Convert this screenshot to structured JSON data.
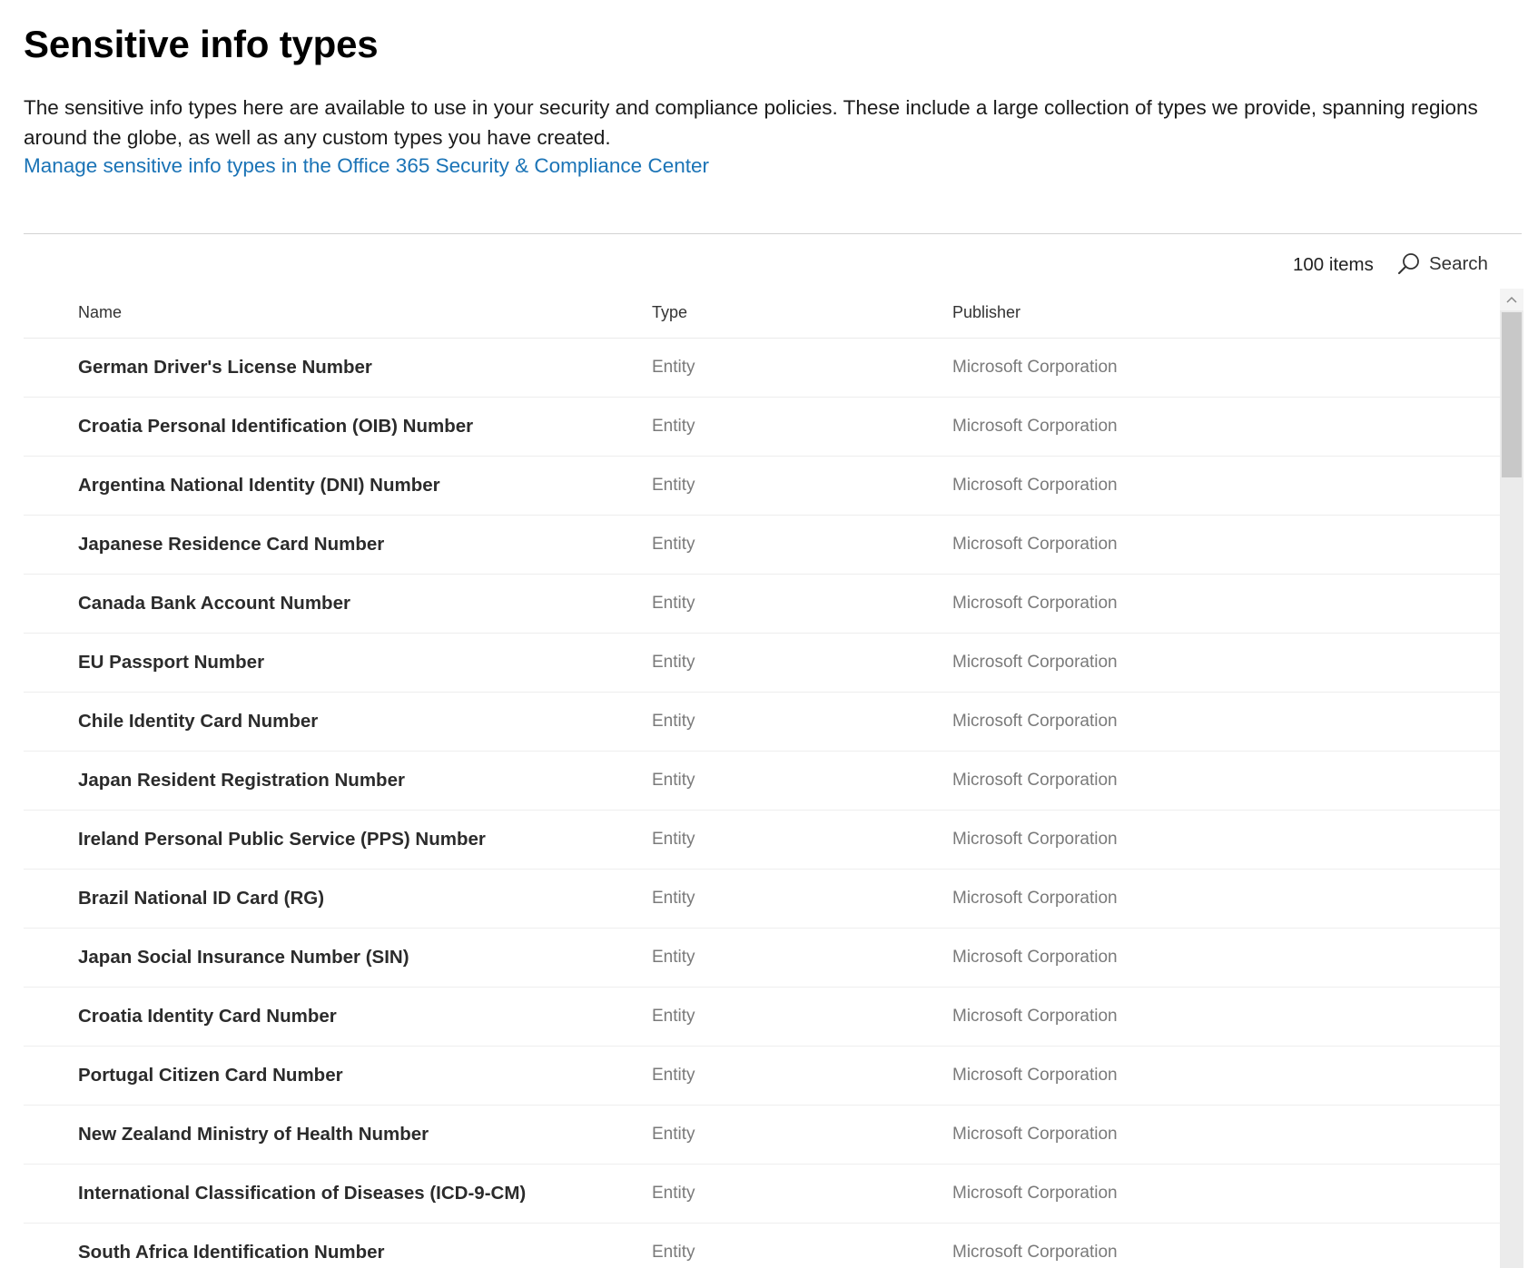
{
  "page": {
    "title": "Sensitive info types",
    "description": "The sensitive info types here are available to use in your security and compliance policies. These include a large collection of types we provide, spanning regions around the globe, as well as any custom types you have created.",
    "link_text": "Manage sensitive info types in the Office 365 Security & Compliance Center"
  },
  "toolbar": {
    "item_count": "100 items",
    "search_label": "Search",
    "search_icon": "search-icon"
  },
  "table": {
    "columns": {
      "name": "Name",
      "type": "Type",
      "publisher": "Publisher"
    },
    "rows": [
      {
        "name": "German Driver's License Number",
        "type": "Entity",
        "publisher": "Microsoft Corporation"
      },
      {
        "name": "Croatia Personal Identification (OIB) Number",
        "type": "Entity",
        "publisher": "Microsoft Corporation"
      },
      {
        "name": "Argentina National Identity (DNI) Number",
        "type": "Entity",
        "publisher": "Microsoft Corporation"
      },
      {
        "name": "Japanese Residence Card Number",
        "type": "Entity",
        "publisher": "Microsoft Corporation"
      },
      {
        "name": "Canada Bank Account Number",
        "type": "Entity",
        "publisher": "Microsoft Corporation"
      },
      {
        "name": "EU Passport Number",
        "type": "Entity",
        "publisher": "Microsoft Corporation"
      },
      {
        "name": "Chile Identity Card Number",
        "type": "Entity",
        "publisher": "Microsoft Corporation"
      },
      {
        "name": "Japan Resident Registration Number",
        "type": "Entity",
        "publisher": "Microsoft Corporation"
      },
      {
        "name": "Ireland Personal Public Service (PPS) Number",
        "type": "Entity",
        "publisher": "Microsoft Corporation"
      },
      {
        "name": "Brazil National ID Card (RG)",
        "type": "Entity",
        "publisher": "Microsoft Corporation"
      },
      {
        "name": "Japan Social Insurance Number (SIN)",
        "type": "Entity",
        "publisher": "Microsoft Corporation"
      },
      {
        "name": "Croatia Identity Card Number",
        "type": "Entity",
        "publisher": "Microsoft Corporation"
      },
      {
        "name": "Portugal Citizen Card Number",
        "type": "Entity",
        "publisher": "Microsoft Corporation"
      },
      {
        "name": "New Zealand Ministry of Health Number",
        "type": "Entity",
        "publisher": "Microsoft Corporation"
      },
      {
        "name": "International Classification of Diseases (ICD-9-CM)",
        "type": "Entity",
        "publisher": "Microsoft Corporation"
      },
      {
        "name": "South Africa Identification Number",
        "type": "Entity",
        "publisher": "Microsoft Corporation"
      }
    ]
  },
  "colors": {
    "link": "#1a73b6",
    "secondary_text": "#7a7a7a",
    "divider": "#d2d2d2"
  }
}
